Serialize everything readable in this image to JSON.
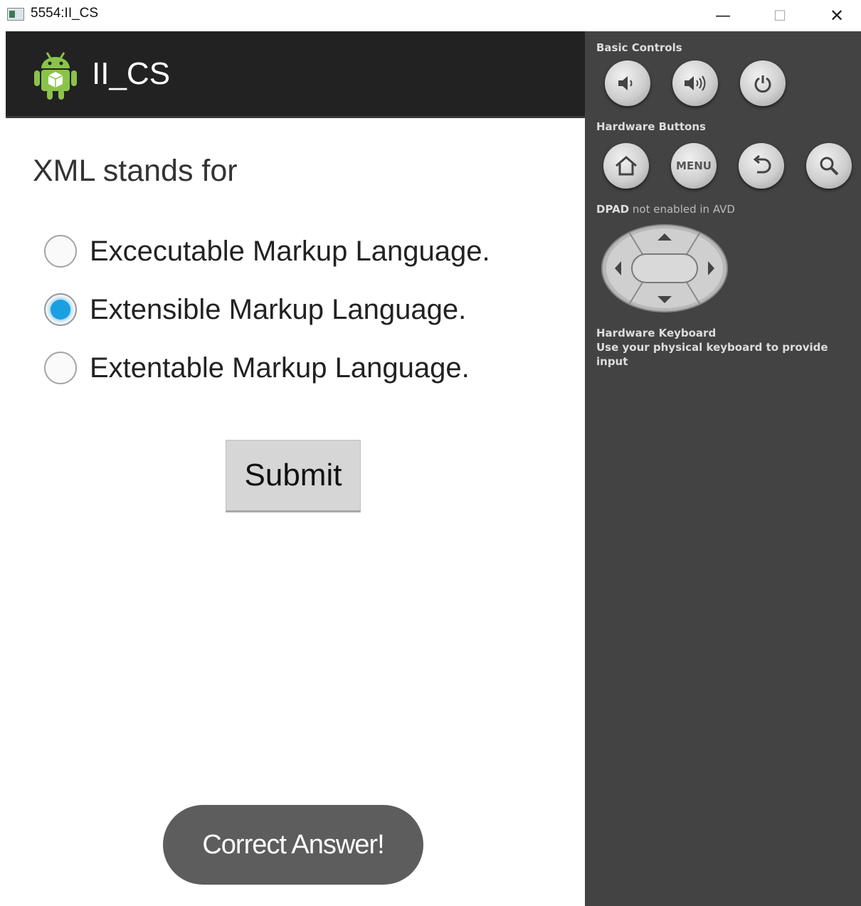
{
  "window": {
    "title": "5554:II_CS",
    "minimize_glyph": "—",
    "maximize_glyph": "☐",
    "close_glyph": "✕"
  },
  "app": {
    "title": "II_CS",
    "icon": "android-robot-icon"
  },
  "quiz": {
    "question": "XML stands for",
    "options": [
      {
        "label": "Excecutable Markup Language.",
        "selected": false
      },
      {
        "label": "Extensible Markup Language.",
        "selected": true
      },
      {
        "label": "Extentable Markup Language.",
        "selected": false
      }
    ],
    "submit_label": "Submit"
  },
  "toast": {
    "text": "Correct Answer!"
  },
  "controls": {
    "basic_controls_label": "Basic Controls",
    "basic_buttons": [
      "volume-down-icon",
      "volume-up-icon",
      "power-icon"
    ],
    "hardware_buttons_label": "Hardware Buttons",
    "hardware_buttons": [
      "home-icon",
      "menu-button",
      "back-icon",
      "search-icon"
    ],
    "menu_label": "MENU",
    "dpad_label_bold": "DPAD",
    "dpad_label_rest": " not enabled in AVD",
    "keyboard_title": "Hardware Keyboard",
    "keyboard_text": "Use your physical keyboard to provide input"
  }
}
